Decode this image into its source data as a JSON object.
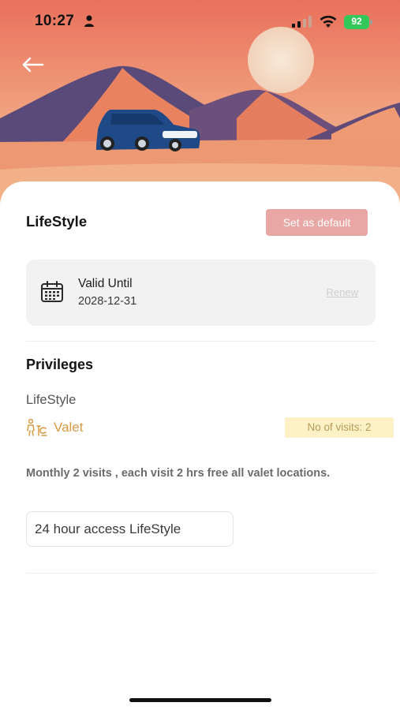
{
  "status_bar": {
    "time": "10:27",
    "battery": "92"
  },
  "plan": {
    "title": "LifeStyle",
    "default_button_label": "Set as default"
  },
  "validity": {
    "label": "Valid Until",
    "date": "2028-12-31",
    "renew_label": "Renew"
  },
  "privileges": {
    "heading": "Privileges",
    "group_name": "LifeStyle",
    "items": [
      {
        "icon": "valet-icon",
        "label": "Valet",
        "visits_badge": "No of visits: 2",
        "description": "Monthly 2 visits , each visit 2 hrs free all valet locations.",
        "access_chip": "24 hour access LifeStyle"
      }
    ]
  },
  "colors": {
    "accent_valet": "#d99a43",
    "default_button": "#e8a6a4",
    "badge_bg": "#fdf2c6",
    "battery": "#34c759"
  }
}
